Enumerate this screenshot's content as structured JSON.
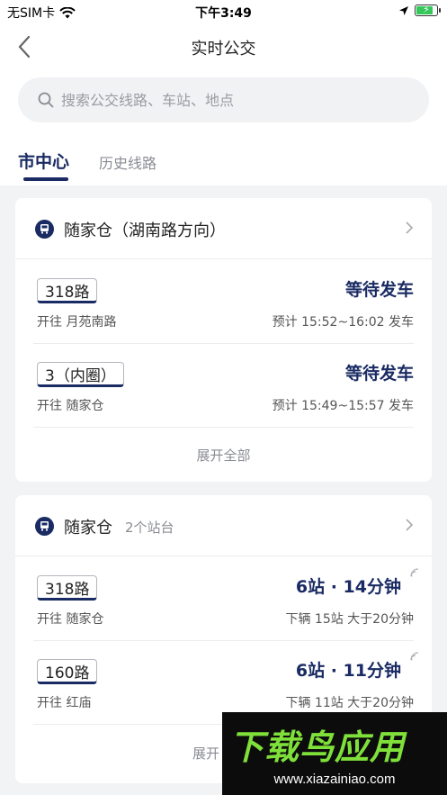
{
  "status_bar": {
    "carrier": "无SIM卡",
    "time": "下午3:49",
    "battery_level": 0.85
  },
  "nav": {
    "title": "实时公交"
  },
  "search": {
    "placeholder": "搜索公交线路、车站、地点"
  },
  "tabs": [
    {
      "label": "市中心"
    },
    {
      "label": "历史线路"
    }
  ],
  "stops": [
    {
      "name": "随家仓（湖南路方向）",
      "subtitle": "",
      "routes": [
        {
          "route": "318路",
          "direction": "开往 月苑南路",
          "status": "等待发车",
          "eta": "预计 15:52~16:02 发车"
        },
        {
          "route": "3（内圈）",
          "direction": "开往 随家仓",
          "status": "等待发车",
          "eta": "预计 15:49~15:57 发车"
        }
      ],
      "expand_label": "展开全部"
    },
    {
      "name": "随家仓",
      "subtitle": "2个站台",
      "routes": [
        {
          "route": "318路",
          "direction": "开往 随家仓",
          "status": "6站 · 14分钟",
          "eta": "下辆 15站 大于20分钟"
        },
        {
          "route": "160路",
          "direction": "开往 红庙",
          "status": "6站 · 11分钟",
          "eta": "下辆 11站 大于20分钟"
        }
      ],
      "expand_label": "展开"
    }
  ],
  "watermark": {
    "main": "下载鸟应用",
    "url": "www.xiazainiao.com"
  },
  "colors": {
    "accent": "#1a2b63",
    "watermark_green": "#7fe03a"
  }
}
